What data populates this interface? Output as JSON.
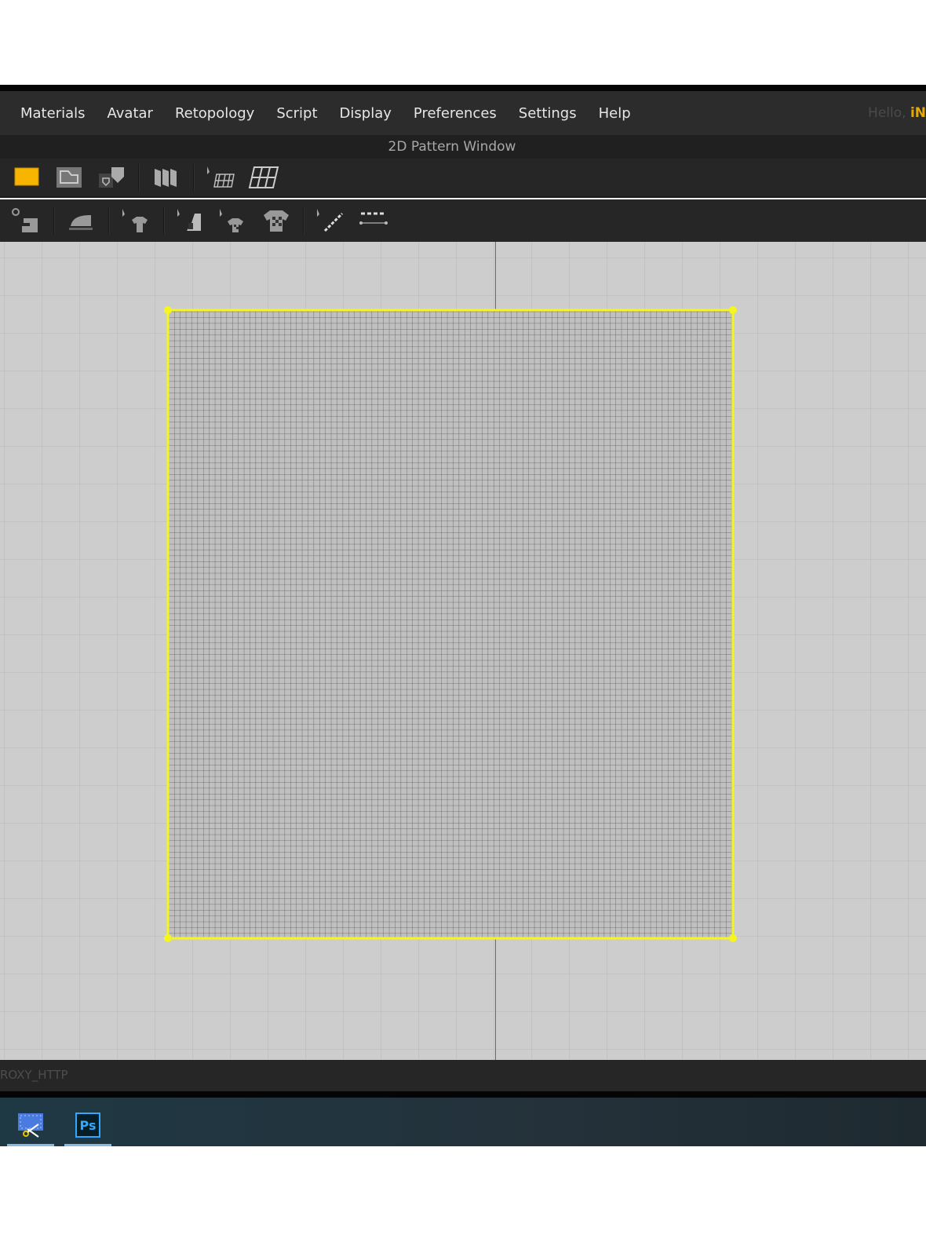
{
  "menubar": {
    "items": [
      "Materials",
      "Avatar",
      "Retopology",
      "Script",
      "Display",
      "Preferences",
      "Settings",
      "Help"
    ],
    "greeting": "Hello,",
    "username": "iN"
  },
  "window_title": "2D Pattern Window",
  "toolbar1": [
    "rectangle-pattern-icon",
    "polygon-pattern-icon",
    "internal-shape-icon",
    "fold-pattern-icon",
    "edit-mesh-icon",
    "mesh-grid-icon"
  ],
  "toolbar2": [
    "sewing-machine-icon",
    "iron-icon",
    "select-garment-icon",
    "select-fabric-icon",
    "select-texture-icon",
    "texture-garment-icon",
    "edit-line-icon",
    "segment-line-icon"
  ],
  "status": {
    "text": "ROXY_HTTP"
  },
  "taskbar": {
    "apps": [
      "Snipping Tool",
      "Ps"
    ]
  },
  "colors": {
    "selection": "#f5f520",
    "accent": "#f7b500"
  }
}
